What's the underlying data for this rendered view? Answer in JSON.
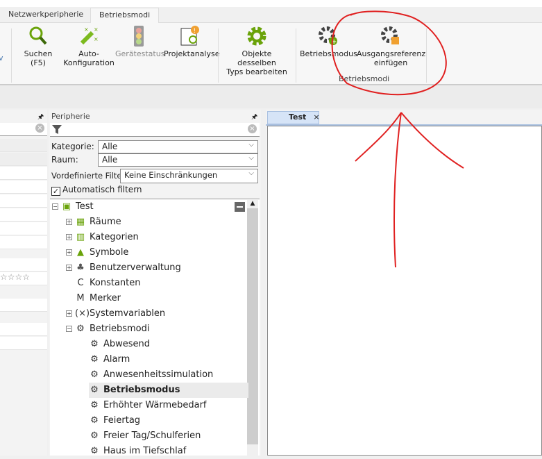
{
  "ribbon": {
    "tabs": [
      {
        "label": "Netzwerkperipherie"
      },
      {
        "label": "Betriebsmodi"
      }
    ],
    "buttons": {
      "suchen": "Suchen",
      "suchen_sub": "(F5)",
      "auto": "Auto-",
      "auto_sub": "Konfiguration",
      "geraetestatus": "Gerätestatus",
      "projektanalyse": "Projektanalyse",
      "objekte": "Objekte desselben",
      "objekte_sub": "Typs bearbeiten",
      "betriebsmodus": "Betriebsmodus",
      "ausgangsreferenz": "Ausgangsreferenz",
      "ausgangsreferenz_sub": "einfügen"
    },
    "group_label": "Betriebsmodi",
    "partial_left": "v"
  },
  "peripherie": {
    "title": "Peripherie",
    "kategorie_label": "Kategorie:",
    "kategorie_value": "Alle",
    "raum_label": "Raum:",
    "raum_value": "Alle",
    "filter_label": "Vordefinierte Filter",
    "filter_value": "Keine Einschränkungen",
    "auto_filter_label": "Automatisch filtern",
    "tree": [
      {
        "label": "Test",
        "icon": "project-icon"
      },
      {
        "label": "Räume",
        "icon": "rooms-icon"
      },
      {
        "label": "Kategorien",
        "icon": "categories-icon"
      },
      {
        "label": "Symbole",
        "icon": "symbols-icon"
      },
      {
        "label": "Benutzerverwaltung",
        "icon": "users-icon"
      },
      {
        "label": "Konstanten",
        "icon": "C"
      },
      {
        "label": "Merker",
        "icon": "M"
      },
      {
        "label": "Systemvariablen",
        "icon": "(×)"
      },
      {
        "label": "Betriebsmodi",
        "icon": "gear-icon"
      },
      {
        "label": "Abwesend",
        "icon": "gear-icon"
      },
      {
        "label": "Alarm",
        "icon": "gear-icon"
      },
      {
        "label": "Anwesenheitssimulation",
        "icon": "gear-icon"
      },
      {
        "label": "Betriebsmodus",
        "icon": "gear-icon"
      },
      {
        "label": "Erhöhter Wärmebedarf",
        "icon": "gear-icon"
      },
      {
        "label": "Feiertag",
        "icon": "gear-icon"
      },
      {
        "label": "Freier Tag/Schulferien",
        "icon": "gear-icon"
      },
      {
        "label": "Haus im Tiefschlaf",
        "icon": "gear-icon"
      }
    ]
  },
  "document": {
    "tab_label": "Test",
    "close": "×"
  },
  "left_panel": {
    "stars": "☆☆☆☆"
  }
}
